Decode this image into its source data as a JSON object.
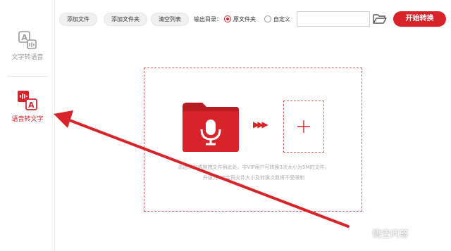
{
  "sidebar": {
    "items": [
      {
        "label": "文字转语音",
        "icon": "text-to-speech-icon",
        "active": false
      },
      {
        "label": "语音转文字",
        "icon": "speech-to-text-icon",
        "active": true
      }
    ]
  },
  "toolbar": {
    "add_file": "添加文件",
    "add_folder": "添加文件夹",
    "clear_list": "清空列表",
    "output_label": "输出目录：",
    "option_source": "原文件夹",
    "option_custom": "自定义",
    "selected_option": "原文件夹",
    "path_value": "",
    "start": "开始转换"
  },
  "dropzone": {
    "hint_line1": "点击添加或拖拽文件到此处。非VIP用户可转换3次大小为5M的文件。",
    "hint_line2": "升级为VIP会员文件大小及转换次数将不受限制"
  },
  "watermark": "悟空问答",
  "colors": {
    "accent": "#d8232a",
    "dashed_border": "#e25b5b",
    "hint_text": "#aaaaaa"
  }
}
